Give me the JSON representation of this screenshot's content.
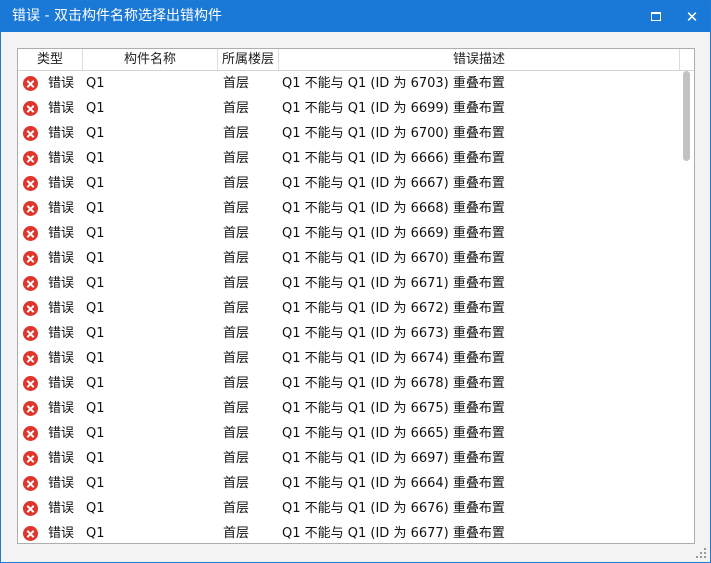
{
  "window": {
    "title": "错误 - 双击构件名称选择出错构件",
    "maximize_icon": "maximize-icon",
    "close_label": "✕"
  },
  "columns": [
    {
      "label": "类型"
    },
    {
      "label": "构件名称"
    },
    {
      "label": "所属楼层"
    },
    {
      "label": "错误描述"
    }
  ],
  "rows": [
    {
      "icon": "error-icon",
      "type": "错误",
      "name": "Q1",
      "floor": "首层",
      "desc": "Q1 不能与 Q1  (ID 为 6703)  重叠布置"
    },
    {
      "icon": "error-icon",
      "type": "错误",
      "name": "Q1",
      "floor": "首层",
      "desc": "Q1 不能与 Q1  (ID 为 6699)  重叠布置"
    },
    {
      "icon": "error-icon",
      "type": "错误",
      "name": "Q1",
      "floor": "首层",
      "desc": "Q1 不能与 Q1  (ID 为 6700)  重叠布置"
    },
    {
      "icon": "error-icon",
      "type": "错误",
      "name": "Q1",
      "floor": "首层",
      "desc": "Q1 不能与 Q1  (ID 为 6666)  重叠布置"
    },
    {
      "icon": "error-icon",
      "type": "错误",
      "name": "Q1",
      "floor": "首层",
      "desc": "Q1 不能与 Q1  (ID 为 6667)  重叠布置"
    },
    {
      "icon": "error-icon",
      "type": "错误",
      "name": "Q1",
      "floor": "首层",
      "desc": "Q1 不能与 Q1  (ID 为 6668)  重叠布置"
    },
    {
      "icon": "error-icon",
      "type": "错误",
      "name": "Q1",
      "floor": "首层",
      "desc": "Q1 不能与 Q1  (ID 为 6669)  重叠布置"
    },
    {
      "icon": "error-icon",
      "type": "错误",
      "name": "Q1",
      "floor": "首层",
      "desc": "Q1 不能与 Q1  (ID 为 6670)  重叠布置"
    },
    {
      "icon": "error-icon",
      "type": "错误",
      "name": "Q1",
      "floor": "首层",
      "desc": "Q1 不能与 Q1  (ID 为 6671)  重叠布置"
    },
    {
      "icon": "error-icon",
      "type": "错误",
      "name": "Q1",
      "floor": "首层",
      "desc": "Q1 不能与 Q1  (ID 为 6672)  重叠布置"
    },
    {
      "icon": "error-icon",
      "type": "错误",
      "name": "Q1",
      "floor": "首层",
      "desc": "Q1 不能与 Q1  (ID 为 6673)  重叠布置"
    },
    {
      "icon": "error-icon",
      "type": "错误",
      "name": "Q1",
      "floor": "首层",
      "desc": "Q1 不能与 Q1  (ID 为 6674)  重叠布置"
    },
    {
      "icon": "error-icon",
      "type": "错误",
      "name": "Q1",
      "floor": "首层",
      "desc": "Q1 不能与 Q1  (ID 为 6678)  重叠布置"
    },
    {
      "icon": "error-icon",
      "type": "错误",
      "name": "Q1",
      "floor": "首层",
      "desc": "Q1 不能与 Q1  (ID 为 6675)  重叠布置"
    },
    {
      "icon": "error-icon",
      "type": "错误",
      "name": "Q1",
      "floor": "首层",
      "desc": "Q1 不能与 Q1  (ID 为 6665)  重叠布置"
    },
    {
      "icon": "error-icon",
      "type": "错误",
      "name": "Q1",
      "floor": "首层",
      "desc": "Q1 不能与 Q1  (ID 为 6697)  重叠布置"
    },
    {
      "icon": "error-icon",
      "type": "错误",
      "name": "Q1",
      "floor": "首层",
      "desc": "Q1 不能与 Q1  (ID 为 6664)  重叠布置"
    },
    {
      "icon": "error-icon",
      "type": "错误",
      "name": "Q1",
      "floor": "首层",
      "desc": "Q1 不能与 Q1  (ID 为 6676)  重叠布置"
    },
    {
      "icon": "error-icon",
      "type": "错误",
      "name": "Q1",
      "floor": "首层",
      "desc": "Q1 不能与 Q1  (ID 为 6677)  重叠布置"
    }
  ],
  "colors": {
    "titlebar": "#1a78d7",
    "error": "#e0352b"
  }
}
